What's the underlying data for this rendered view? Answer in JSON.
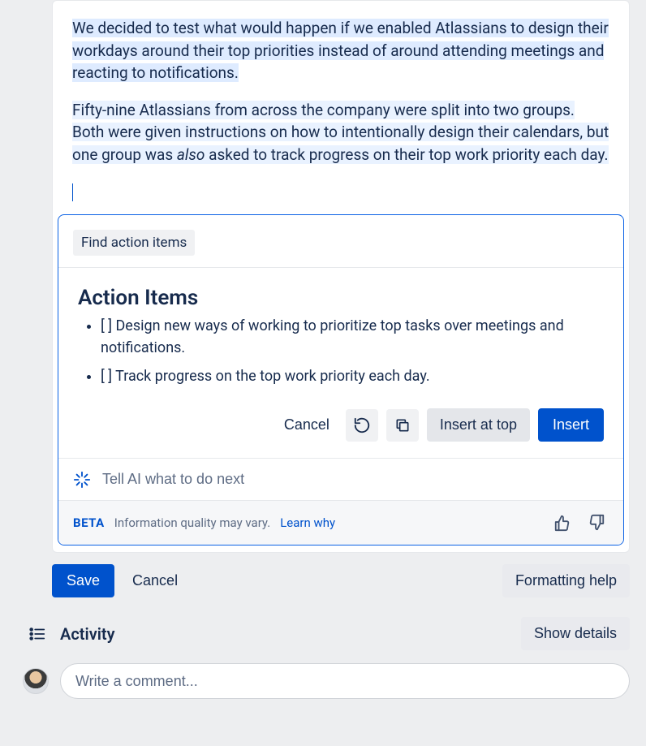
{
  "document": {
    "para1": "We decided to test what would happen if we enabled Atlassians to design their workdays around their top priorities instead of around attending meetings and reacting to notifications.",
    "para2_a": "Fifty-nine Atlassians from across the company were split into two groups. Both were given instructions on how to intentionally design their calendars, but one group was ",
    "para2_em": "also",
    "para2_b": " asked to track progress on their top work priority each day."
  },
  "ai": {
    "chip": "Find action items",
    "title": "Action Items",
    "items": [
      "[ ] Design new ways of working to prioritize top tasks over meetings and notifications.",
      "[ ] Track progress on the top work priority each day."
    ],
    "buttons": {
      "cancel": "Cancel",
      "insert_top": "Insert at top",
      "insert": "Insert"
    },
    "prompt_placeholder": "Tell AI what to do next",
    "beta": "BETA",
    "disclaimer": "Information quality may vary.",
    "learn": "Learn why"
  },
  "lower": {
    "save": "Save",
    "cancel": "Cancel",
    "formatting": "Formatting help"
  },
  "activity": {
    "title": "Activity",
    "show_details": "Show details"
  },
  "comment": {
    "placeholder": "Write a comment..."
  }
}
